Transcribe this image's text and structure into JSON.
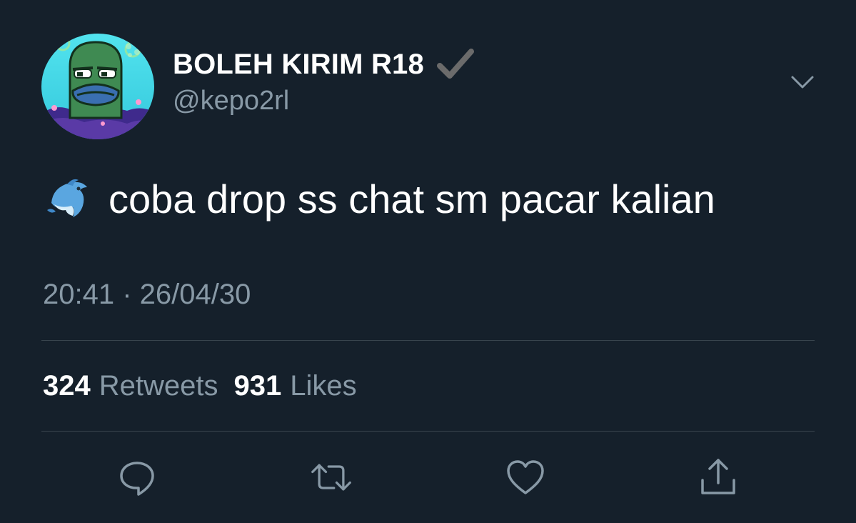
{
  "tweet": {
    "author": {
      "display_name": "BOLEH KIRIM R18",
      "handle": "@kepo2rl",
      "verified_icon": "check-icon",
      "avatar_icon": "avatar"
    },
    "text": "coba drop ss chat sm pacar kalian",
    "leading_emoji_icon": "dolphin-icon",
    "timestamp": "20:41 · 26/04/30",
    "stats": {
      "retweets_count": "324",
      "retweets_label": "Retweets",
      "likes_count": "931",
      "likes_label": "Likes"
    },
    "actions": [
      {
        "icon": "reply-icon"
      },
      {
        "icon": "retweet-icon"
      },
      {
        "icon": "like-icon"
      },
      {
        "icon": "share-icon"
      }
    ],
    "menu_icon": "chevron-down-icon"
  },
  "colors": {
    "background": "#15202b",
    "primary_text": "#ffffff",
    "secondary_text": "#8899a6",
    "divider": "#38444d"
  }
}
